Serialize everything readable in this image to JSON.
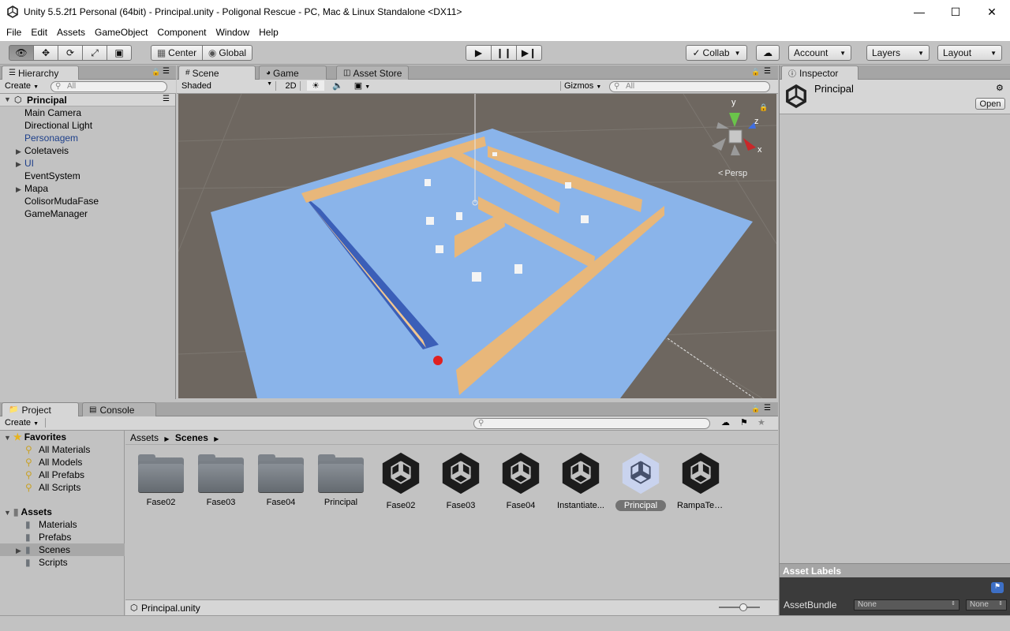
{
  "window": {
    "title": "Unity 5.5.2f1 Personal (64bit) - Principal.unity - Poligonal Rescue - PC, Mac & Linux Standalone <DX11>"
  },
  "menu": [
    "File",
    "Edit",
    "Assets",
    "GameObject",
    "Component",
    "Window",
    "Help"
  ],
  "toolbar": {
    "center": "Center",
    "global": "Global",
    "collab": "Collab",
    "account": "Account",
    "layers": "Layers",
    "layout": "Layout"
  },
  "hierarchy": {
    "tab": "Hierarchy",
    "create": "Create",
    "search_placeholder": "All",
    "scene": "Principal",
    "items": [
      {
        "label": "Main Camera",
        "expandable": false,
        "color": "#000000"
      },
      {
        "label": "Directional Light",
        "expandable": false,
        "color": "#000000"
      },
      {
        "label": "Personagem",
        "expandable": false,
        "color": "#1d3f8a"
      },
      {
        "label": "Coletaveis",
        "expandable": true,
        "color": "#000000"
      },
      {
        "label": "UI",
        "expandable": true,
        "color": "#1d3f8a"
      },
      {
        "label": "EventSystem",
        "expandable": false,
        "color": "#000000"
      },
      {
        "label": "Mapa",
        "expandable": true,
        "color": "#000000"
      },
      {
        "label": "ColisorMudaFase",
        "expandable": false,
        "color": "#000000"
      },
      {
        "label": "GameManager",
        "expandable": false,
        "color": "#000000"
      }
    ]
  },
  "scene_view": {
    "tabs": [
      "Scene",
      "Game",
      "Asset Store"
    ],
    "shaded": "Shaded",
    "mode2d": "2D",
    "gizmos": "Gizmos",
    "search_placeholder": "All",
    "persp": "Persp",
    "axis_y": "y",
    "axis_z": "z",
    "axis_x": "x"
  },
  "inspector": {
    "tab": "Inspector",
    "name": "Principal",
    "open": "Open",
    "asset_labels": "Asset Labels",
    "assetbundle": "AssetBundle",
    "none1": "None",
    "none2": "None"
  },
  "project": {
    "tabs": [
      "Project",
      "Console"
    ],
    "create": "Create",
    "favorites": "Favorites",
    "fav_items": [
      "All Materials",
      "All Models",
      "All Prefabs",
      "All Scripts"
    ],
    "assets": "Assets",
    "asset_folders": [
      "Materials",
      "Prefabs",
      "Scenes",
      "Scripts"
    ],
    "breadcrumb": [
      "Assets",
      "Scenes"
    ],
    "items": [
      {
        "label": "Fase02",
        "kind": "folder"
      },
      {
        "label": "Fase03",
        "kind": "folder"
      },
      {
        "label": "Fase04",
        "kind": "folder"
      },
      {
        "label": "Principal",
        "kind": "folder"
      },
      {
        "label": "Fase02",
        "kind": "unity"
      },
      {
        "label": "Fase03",
        "kind": "unity"
      },
      {
        "label": "Fase04",
        "kind": "unity"
      },
      {
        "label": "Instantiate...",
        "kind": "unity"
      },
      {
        "label": "Principal",
        "kind": "unity",
        "selected": true
      },
      {
        "label": "RampaTeste",
        "kind": "unity"
      }
    ],
    "footer": "Principal.unity"
  },
  "colors": {
    "accent": "#3d6fc5",
    "ground": "#8ab4ea",
    "wall": "#e8b77a",
    "ball": "#e02020",
    "bg_grid": "#6f6961"
  }
}
